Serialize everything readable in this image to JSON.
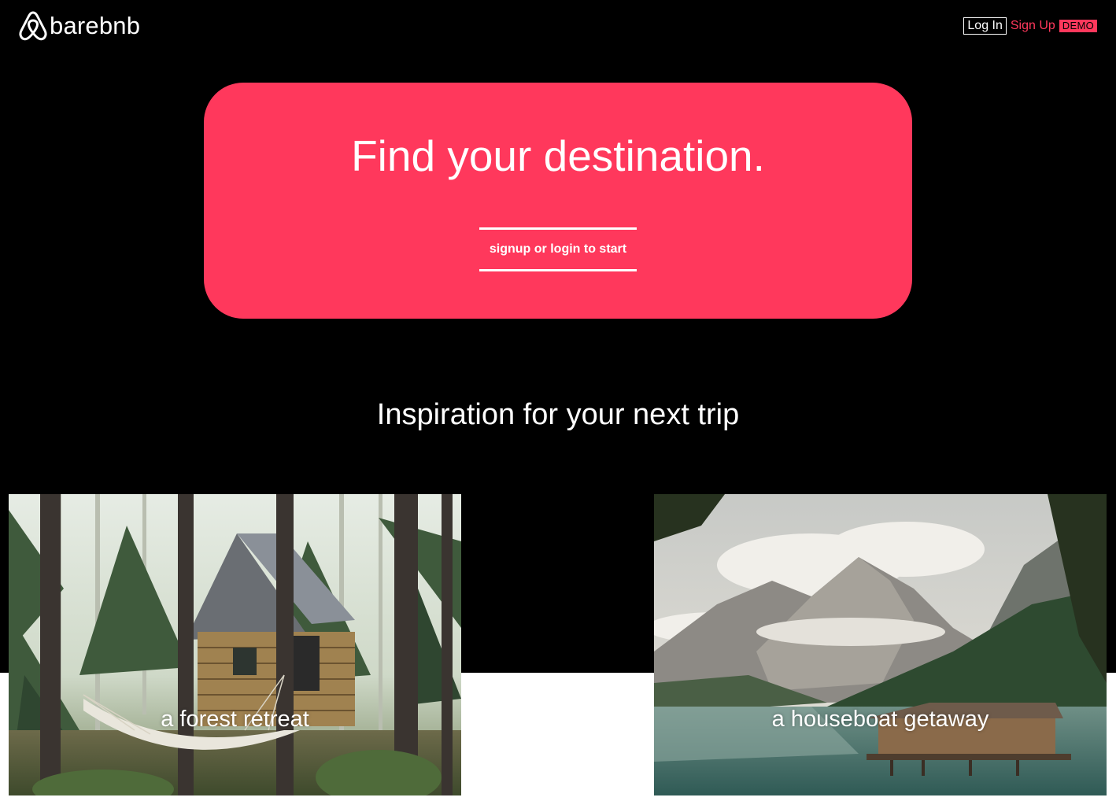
{
  "header": {
    "brand": "barebnb",
    "logo_icon": "airbnb-belo-icon",
    "login_label": "Log In",
    "signup_label": "Sign Up",
    "demo_label": "DEMO"
  },
  "hero": {
    "title": "Find your destination.",
    "cta_label": "signup or login to start",
    "background_color": "#ff385c"
  },
  "inspiration": {
    "heading": "Inspiration for your next trip",
    "cards": [
      {
        "label": "a forest retreat",
        "image": "forest-cabin-with-hammock"
      },
      {
        "label": "a houseboat getaway",
        "image": "mountain-lake-boathouse"
      }
    ]
  },
  "colors": {
    "accent": "#ff385c",
    "background": "#000000",
    "text": "#ffffff"
  }
}
